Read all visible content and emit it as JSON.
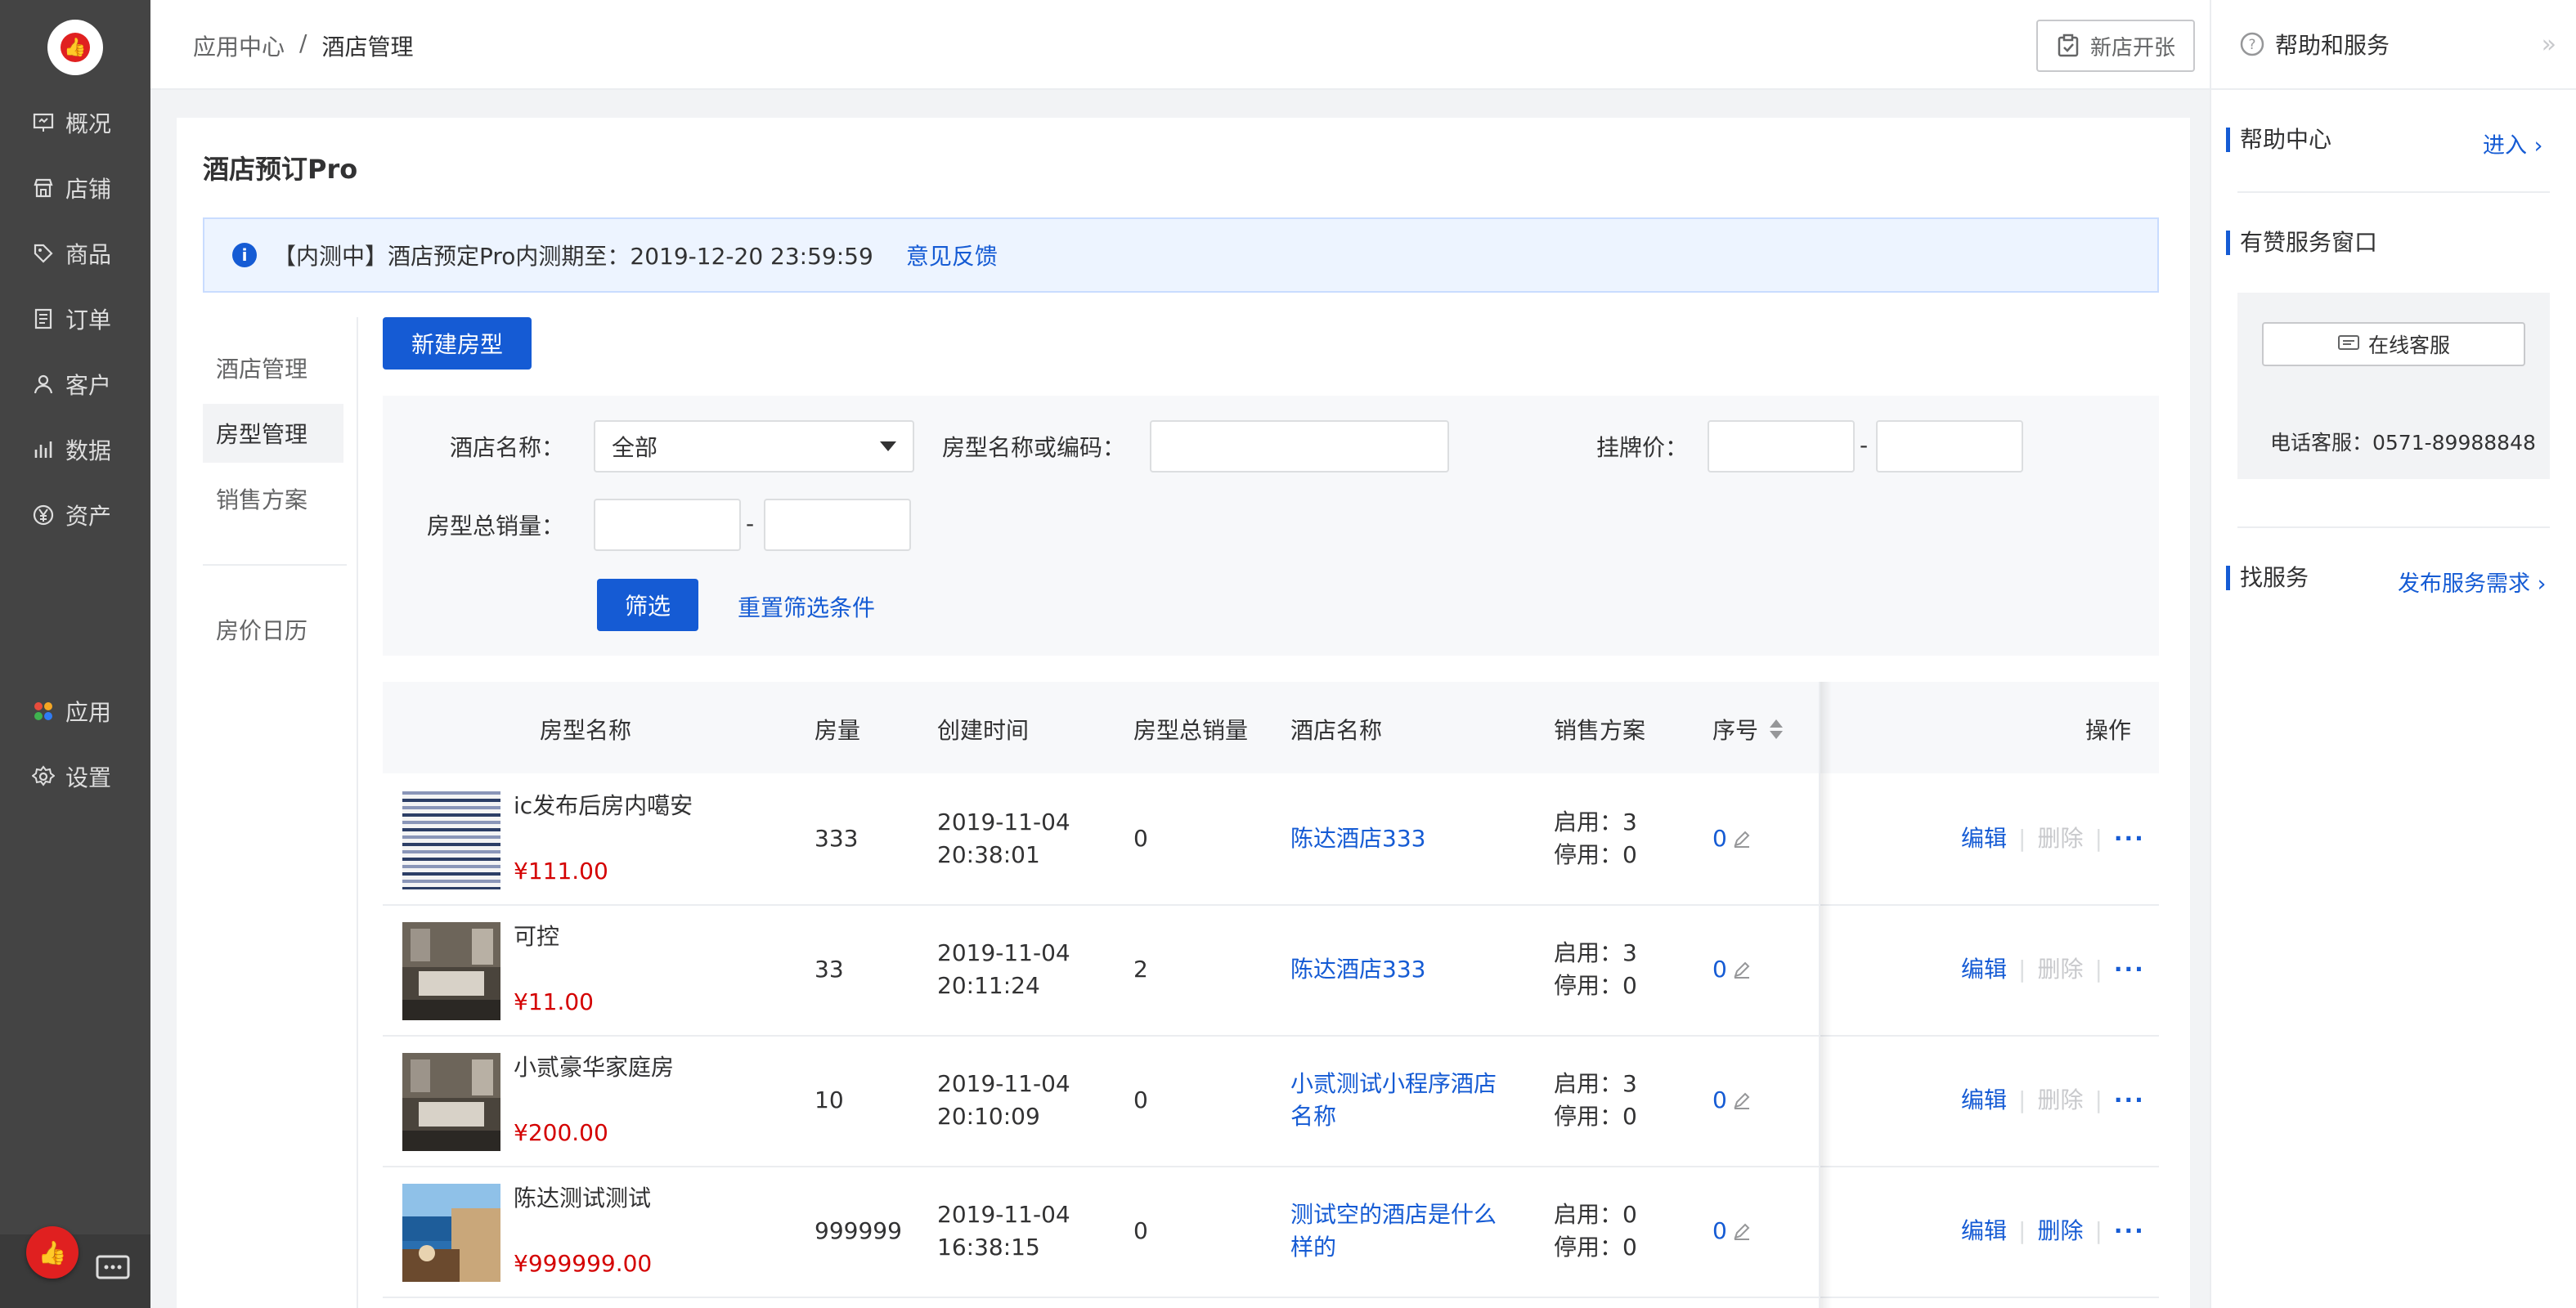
{
  "nav": {
    "items": [
      {
        "label": "概况",
        "icon": "overview-icon"
      },
      {
        "label": "店铺",
        "icon": "store-icon"
      },
      {
        "label": "商品",
        "icon": "tag-icon"
      },
      {
        "label": "订单",
        "icon": "order-icon"
      },
      {
        "label": "客户",
        "icon": "user-icon"
      },
      {
        "label": "数据",
        "icon": "chart-icon"
      },
      {
        "label": "资产",
        "icon": "yen-icon"
      }
    ],
    "apps_label": "应用",
    "settings_label": "设置"
  },
  "header": {
    "breadcrumb": [
      "应用中心",
      "/",
      "酒店管理"
    ],
    "new_store_label": "新店开张"
  },
  "right_panel": {
    "title": "帮助和服务",
    "help_center": "帮助中心",
    "enter": "进入",
    "service_window": "有赞服务窗口",
    "online_service": "在线客服",
    "phone": "电话客服：0571-89988848",
    "find_service": "找服务",
    "publish_demand": "发布服务需求"
  },
  "page": {
    "title": "酒店预订Pro",
    "notice": "【内测中】酒店预定Pro内测期至：2019-12-20 23:59:59",
    "feedback": "意见反馈"
  },
  "submenu": [
    "酒店管理",
    "房型管理",
    "销售方案",
    "房价日历"
  ],
  "toolbar": {
    "new_room_type": "新建房型"
  },
  "filter": {
    "hotel_label": "酒店名称：",
    "hotel_value": "全部",
    "room_label": "房型名称或编码：",
    "price_label": "挂牌价：",
    "sales_label": "房型总销量：",
    "dash": "-",
    "filter_btn": "筛选",
    "reset": "重置筛选条件"
  },
  "table": {
    "headers": [
      "房型名称",
      "房量",
      "创建时间",
      "房型总销量",
      "酒店名称",
      "销售方案",
      "序号",
      "操作"
    ],
    "ops": {
      "edit": "编辑",
      "delete": "删除",
      "sep": "|",
      "more": "···"
    },
    "rows": [
      {
        "name": "ic发布后房内噶安",
        "price": "¥111.00",
        "qty": "333",
        "date": "2019-11-04",
        "time": "20:38:01",
        "sales": "0",
        "hotel": [
          "陈达酒店333"
        ],
        "on": "启用：3",
        "off": "停用：0",
        "seq": "0",
        "delete_enabled": false,
        "thumb": "stripes"
      },
      {
        "name": "可控",
        "price": "¥11.00",
        "qty": "33",
        "date": "2019-11-04",
        "time": "20:11:24",
        "sales": "2",
        "hotel": [
          "陈达酒店333"
        ],
        "on": "启用：3",
        "off": "停用：0",
        "seq": "0",
        "delete_enabled": false,
        "thumb": "room"
      },
      {
        "name": "小贰豪华家庭房",
        "price": "¥200.00",
        "qty": "10",
        "date": "2019-11-04",
        "time": "20:10:09",
        "sales": "0",
        "hotel": [
          "小贰测试小程序酒店",
          "名称"
        ],
        "on": "启用：3",
        "off": "停用：0",
        "seq": "0",
        "delete_enabled": false,
        "thumb": "room"
      },
      {
        "name": "陈达测试测试",
        "price": "¥999999.00",
        "qty": "999999",
        "date": "2019-11-04",
        "time": "16:38:15",
        "sales": "0",
        "hotel": [
          "测试空的酒店是什么",
          "样的"
        ],
        "on": "启用：0",
        "off": "停用：0",
        "seq": "0",
        "delete_enabled": true,
        "thumb": "resort"
      }
    ]
  }
}
